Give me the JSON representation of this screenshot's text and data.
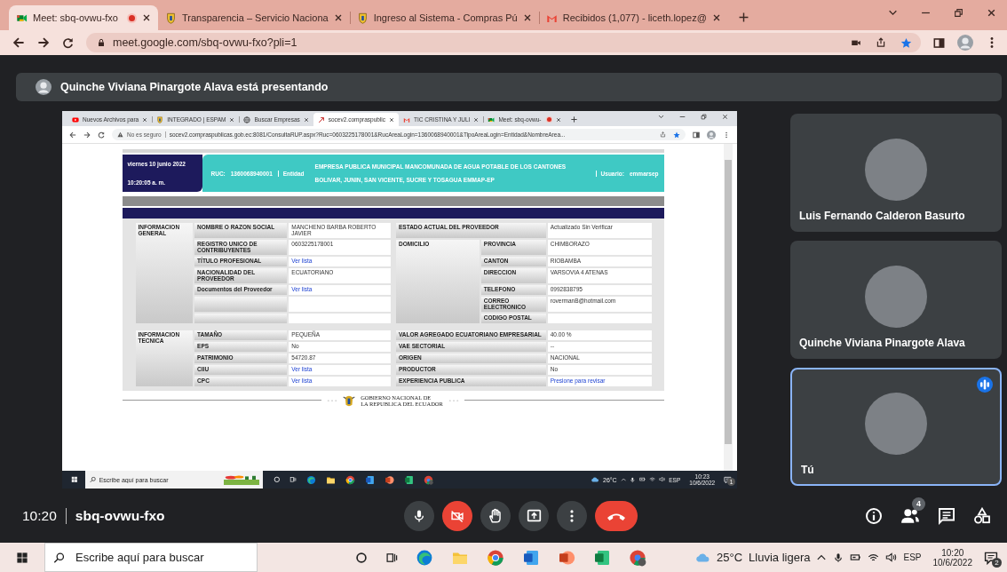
{
  "browser": {
    "tabs": [
      {
        "title": "Meet: sbq-ovwu-fxo",
        "kind": "meet",
        "recording": true,
        "selected": true
      },
      {
        "title": "Transparencia – Servicio Naciona",
        "kind": "emblem",
        "recording": false,
        "selected": false
      },
      {
        "title": "Ingreso al Sistema - Compras Pú",
        "kind": "emblem",
        "recording": false,
        "selected": false
      },
      {
        "title": "Recibidos (1,077) - liceth.lopez@",
        "kind": "gmail",
        "recording": false,
        "selected": false
      }
    ],
    "url": "meet.google.com/sbq-ovwu-fxo?pli=1"
  },
  "meeting": {
    "presenter": "Quinche Viviana Pinargote Alava está presentando",
    "shared_screen": {
      "tabs": [
        {
          "title": "Nuevos Archivos para",
          "kind": "youtube",
          "recording": false,
          "selected": false
        },
        {
          "title": "INTEGRADO | ESPAM",
          "kind": "emblem",
          "recording": false,
          "selected": false
        },
        {
          "title": "Buscar Empresas",
          "kind": "globe",
          "recording": false,
          "selected": false
        },
        {
          "title": "socev2.compraspublic",
          "kind": "arrow",
          "recording": false,
          "selected": true
        },
        {
          "title": "TIC CRISTINA Y JULI",
          "kind": "gmail",
          "recording": false,
          "selected": false
        },
        {
          "title": "Meet: sbq-ovwu-",
          "kind": "meet",
          "recording": true,
          "selected": false
        }
      ],
      "security_label": "No es seguro",
      "url": "socev2.compraspublicas.gob.ec:8081/ConsultaRUP.aspx?Ruc=0603225178001&RucAreaLogin=1360068940001&TipoAreaLogin=Entidad&NombreArea...",
      "portal": {
        "date": "viernes 10 junio 2022",
        "time": "10:20:05 a. m.",
        "ruc_label": "RUC:",
        "ruc": "1360068940001",
        "entity_label": "Entidad",
        "entity_lines": [
          "EMPRESA PUBLICA MUNICIPAL MANCOMUNADA DE AGUA POTABLE DE LOS CANTONES",
          "BOLIVAR, JUNIN, SAN VICENTE, SUCRE Y TOSAGUA EMMAP-EP"
        ],
        "user_label": "Usuario:",
        "user": "emmarsep",
        "sections": [
          {
            "title": "INFORMACION GENERAL",
            "left": [
              {
                "label": "NOMBRE O RAZON SOCIAL",
                "value": "MANCHENO BARBA ROBERTO JAVIER",
                "kind": "text"
              },
              {
                "label": "REGISTRO UNICO DE CONTRIBUYENTES",
                "value": "0603225178001",
                "kind": "text"
              },
              {
                "label": "TÍTULO PROFESIONAL",
                "value": "Ver lista",
                "kind": "link"
              },
              {
                "label": "NACIONALIDAD DEL PROVEEDOR",
                "value": "ECUATORIANO",
                "kind": "text"
              },
              {
                "label": "Documentos del Proveedor",
                "value": "Ver lista",
                "kind": "link"
              }
            ],
            "right": [
              {
                "label": "ESTADO ACTUAL DEL PROVEEDOR",
                "value": "Actualizado Sin Verificar",
                "kind": "text"
              },
              {
                "label": "DOMICILIO",
                "children": [
                  {
                    "label": "PROVINCIA",
                    "value": "CHIMBORAZO",
                    "kind": "text"
                  },
                  {
                    "label": "CANTON",
                    "value": "RIOBAMBA",
                    "kind": "text"
                  },
                  {
                    "label": "DIRECCION",
                    "value": "VARSOVIA 4 ATENAS",
                    "kind": "text"
                  },
                  {
                    "label": "TELEFONO",
                    "value": "0992838795",
                    "kind": "text"
                  },
                  {
                    "label": "CORREO ELECTRONICO",
                    "value": "rovermanB@hotmail.com",
                    "kind": "text"
                  },
                  {
                    "label": "CODIGO POSTAL"
                  }
                ]
              }
            ]
          },
          {
            "title": "INFORMACION TECNICA",
            "left": [
              {
                "label": "TAMAÑO",
                "value": "PEQUEÑA",
                "kind": "text"
              },
              {
                "label": "EPS",
                "value": "No",
                "kind": "text"
              },
              {
                "label": "PATRIMONIO",
                "value": "54720.87",
                "kind": "text"
              },
              {
                "label": "CIIU",
                "value": "Ver lista",
                "kind": "link"
              },
              {
                "label": "CPC",
                "value": "Ver lista",
                "kind": "link"
              }
            ],
            "right": [
              {
                "label": "VALOR AGREGADO ECUATORIANO EMPRESARIAL",
                "value": "40.00 %",
                "kind": "text"
              },
              {
                "label": "VAE SECTORIAL",
                "value": "--",
                "kind": "text"
              },
              {
                "label": "ORIGEN",
                "value": "NACIONAL",
                "kind": "text"
              },
              {
                "label": "PRODUCTOR",
                "value": "No",
                "kind": "text"
              },
              {
                "label": "EXPERIENCIA PUBLICA",
                "value": "Presione para revisar",
                "kind": "link"
              }
            ]
          }
        ],
        "footer_lines": [
          "GOBIERNO NACIONAL DE",
          "LA REPUBLICA DEL ECUADOR"
        ]
      },
      "taskbar": {
        "search_placeholder": "Escribe aquí para buscar",
        "temperature": "26°C",
        "language": "ESP",
        "time": "10:23",
        "date": "10/6/2022",
        "notifications": "1"
      }
    },
    "participants": [
      {
        "name": "Luis Fernando Calderon Basurto",
        "speaking": false
      },
      {
        "name": "Quinche Viviana Pinargote Alava",
        "speaking": false
      },
      {
        "name": "Tú",
        "speaking": true
      }
    ],
    "time": "10:20",
    "code": "sbq-ovwu-fxo",
    "controls": [
      {
        "kind": "mic",
        "on": true
      },
      {
        "kind": "camera",
        "on": false
      },
      {
        "kind": "hand"
      },
      {
        "kind": "present"
      },
      {
        "kind": "more"
      },
      {
        "kind": "end"
      }
    ],
    "people_count": "4"
  },
  "taskbar": {
    "search_placeholder": "Escribe aquí para buscar",
    "temperature": "25°C",
    "weather": "Lluvia ligera",
    "language": "ESP",
    "time": "10:20",
    "date": "10/6/2022",
    "notifications": "2"
  }
}
